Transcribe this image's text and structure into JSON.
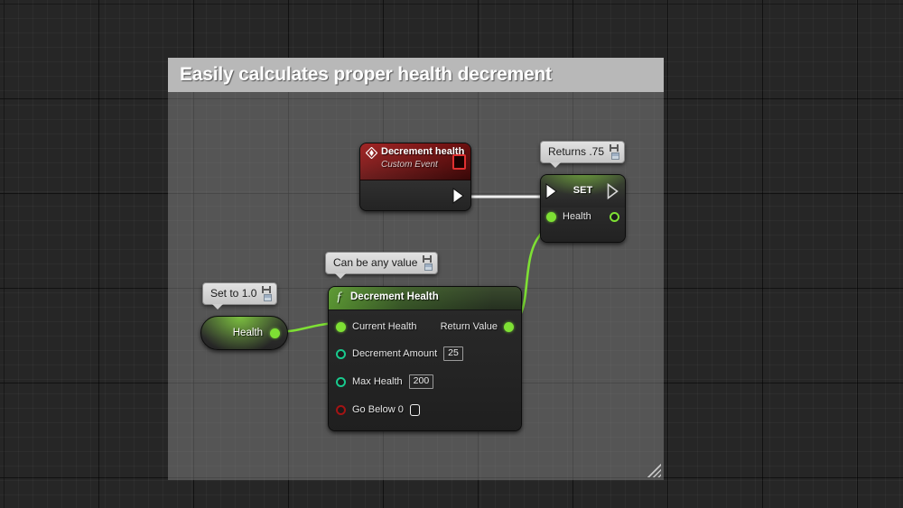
{
  "graph": {
    "comment": {
      "title": "Easily calculates proper health decrement",
      "resize_grip": "resize-grip"
    }
  },
  "nodes": {
    "custom_event": {
      "title": "Decrement health",
      "subtitle": "Custom Event",
      "icon": "event-diamond-icon",
      "delegate_pin": "delegate-output-pin",
      "exec_out": "exec-output-pin"
    },
    "set_node": {
      "title": "SET",
      "exec_in": "exec-input-pin",
      "exec_out": "exec-output-pin",
      "property_label": "Health",
      "input_pin": "health-input-pin",
      "output_pin": "health-output-pin"
    },
    "function_node": {
      "icon": "function-f-icon",
      "title": "Decrement Health",
      "inputs": [
        {
          "label": "Current Health",
          "pin": "filled-green",
          "value": null
        },
        {
          "label": "Decrement Amount",
          "pin": "hollow-teal",
          "value": "25"
        },
        {
          "label": "Max Health",
          "pin": "hollow-teal",
          "value": "200"
        },
        {
          "label": "Go Below 0",
          "pin": "hollow-red",
          "value": "",
          "control": "checkbox",
          "checked": false
        }
      ],
      "outputs": [
        {
          "label": "Return Value",
          "pin": "filled-green"
        }
      ]
    },
    "variable_getter": {
      "label": "Health",
      "output_pin": "health-output-pin"
    }
  },
  "tooltips": [
    {
      "id": "returns",
      "text": "Returns .75",
      "pin_icon": "pushpin-icon",
      "button_icon": "window-icon"
    },
    {
      "id": "anyvalue",
      "text": "Can be any value",
      "pin_icon": "pushpin-icon",
      "button_icon": "window-icon"
    },
    {
      "id": "setto",
      "text": "Set to 1.0",
      "pin_icon": "pushpin-icon",
      "button_icon": "window-icon"
    }
  ],
  "colors": {
    "exec_wire": "#f0f0f0",
    "data_wire": "#7ee034",
    "event_header": "#8e1414",
    "pin_green": "#7ee034",
    "pin_teal": "#19c98d",
    "pin_red": "#a31414",
    "comment_header": "#b8b8b8"
  }
}
